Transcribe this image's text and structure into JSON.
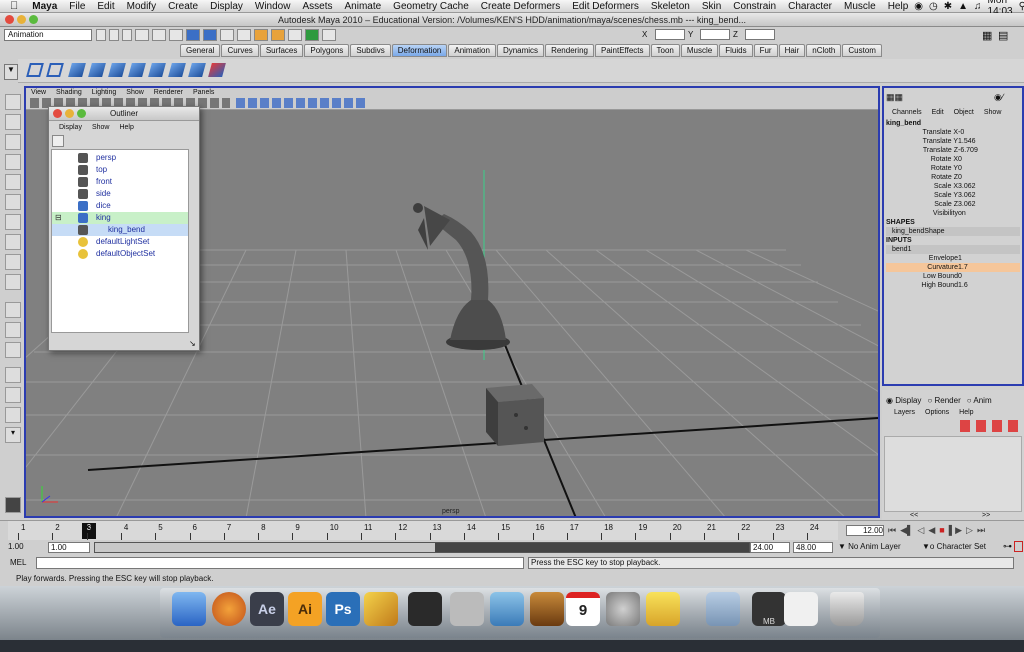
{
  "menubar": {
    "app": "Maya",
    "items": [
      "File",
      "Edit",
      "Modify",
      "Create",
      "Display",
      "Window",
      "Assets",
      "Animate",
      "Geometry Cache",
      "Create Deformers",
      "Edit Deformers",
      "Skeleton",
      "Skin",
      "Constrain",
      "Character",
      "Muscle",
      "Help"
    ],
    "clock": "Mon 14:03"
  },
  "window": {
    "title": "Autodesk Maya 2010 – Educational Version: /Volumes/KEN'S HDD/animation/maya/scenes/chess.mb  ---  king_bend..."
  },
  "status_line": {
    "mode": "Animation",
    "x_label": "X",
    "y_label": "Y",
    "z_label": "Z"
  },
  "shelf": {
    "tabs": [
      "General",
      "Curves",
      "Surfaces",
      "Polygons",
      "Subdivs",
      "Deformation",
      "Animation",
      "Dynamics",
      "Rendering",
      "PaintEffects",
      "Toon",
      "Muscle",
      "Fluids",
      "Fur",
      "Hair",
      "nCloth",
      "Custom"
    ],
    "active_tab": "Deformation"
  },
  "viewport": {
    "menu": [
      "View",
      "Shading",
      "Lighting",
      "Show",
      "Renderer",
      "Panels"
    ],
    "camera_label": "persp"
  },
  "outliner": {
    "title": "Outliner",
    "menu": [
      "Display",
      "Show",
      "Help"
    ],
    "items": [
      {
        "label": "persp",
        "icon": "camera-icon"
      },
      {
        "label": "top",
        "icon": "camera-icon"
      },
      {
        "label": "front",
        "icon": "camera-icon"
      },
      {
        "label": "side",
        "icon": "camera-icon"
      },
      {
        "label": "dice",
        "icon": "transform-icon"
      },
      {
        "label": "king",
        "icon": "transform-icon"
      },
      {
        "label": "king_bend",
        "icon": "deformer-icon"
      },
      {
        "label": "defaultLightSet",
        "icon": "set-icon"
      },
      {
        "label": "defaultObjectSet",
        "icon": "set-icon"
      }
    ]
  },
  "channel_box": {
    "menu": [
      "Channels",
      "Edit",
      "Object",
      "Show"
    ],
    "object": "king_bend",
    "channels": [
      {
        "name": "Translate X",
        "value": "-0"
      },
      {
        "name": "Translate Y",
        "value": "1.546"
      },
      {
        "name": "Translate Z",
        "value": "-6.709"
      },
      {
        "name": "Rotate X",
        "value": "0"
      },
      {
        "name": "Rotate Y",
        "value": "0"
      },
      {
        "name": "Rotate Z",
        "value": "0"
      },
      {
        "name": "Scale X",
        "value": "3.062"
      },
      {
        "name": "Scale Y",
        "value": "3.062"
      },
      {
        "name": "Scale Z",
        "value": "3.062"
      },
      {
        "name": "Visibility",
        "value": "on"
      }
    ],
    "shapes_header": "SHAPES",
    "shape": "king_bendShape",
    "inputs_header": "INPUTS",
    "input": "bend1",
    "input_channels": [
      {
        "name": "Envelope",
        "value": "1"
      },
      {
        "name": "Curvature",
        "value": "1.7"
      },
      {
        "name": "Low Bound",
        "value": "0"
      },
      {
        "name": "High Bound",
        "value": "1.6"
      }
    ]
  },
  "layer_editor": {
    "modes": [
      "Display",
      "Render",
      "Anim"
    ],
    "menu": [
      "Layers",
      "Options",
      "Help"
    ],
    "nav_prev": "<<",
    "nav_next": ">>"
  },
  "timeline": {
    "ticks": [
      "1",
      "2",
      "3",
      "4",
      "5",
      "6",
      "7",
      "8",
      "9",
      "10",
      "11",
      "12",
      "13",
      "14",
      "15",
      "16",
      "17",
      "18",
      "19",
      "20",
      "21",
      "22",
      "23",
      "24"
    ],
    "current_frame": "3",
    "current_time_field": "12.00"
  },
  "range": {
    "start": "1.00",
    "playback_start": "1.00",
    "slider_label": "24.00",
    "playback_end": "24.00",
    "end": "48.00",
    "anim_layer": "No Anim Layer",
    "character_set": "o Character Set"
  },
  "command_line": {
    "label": "MEL",
    "feedback": "Press the ESC key to stop playback."
  },
  "help_line": {
    "text": "Play forwards. Pressing the ESC key will stop playback."
  },
  "dock": {
    "items": [
      "finder-icon",
      "firefox-icon",
      "after-effects-icon",
      "illustrator-icon",
      "photoshop-icon",
      "pencil-icon",
      "maya-icon",
      "camera-icon",
      "iphoto-icon",
      "garageband-icon",
      "ical-icon",
      "system-preferences-icon",
      "ftp-icon",
      "folder-icon",
      "maya-file-icon",
      "preview-icon",
      "trash-icon"
    ],
    "ical_day": "9",
    "mb_label": "MB"
  },
  "colors": {
    "viewport_border": "#2b3cb0",
    "active_tab": "#7aa8e8",
    "selected_row": "#c8f0c8",
    "selected_channel": "#f5c69a"
  }
}
